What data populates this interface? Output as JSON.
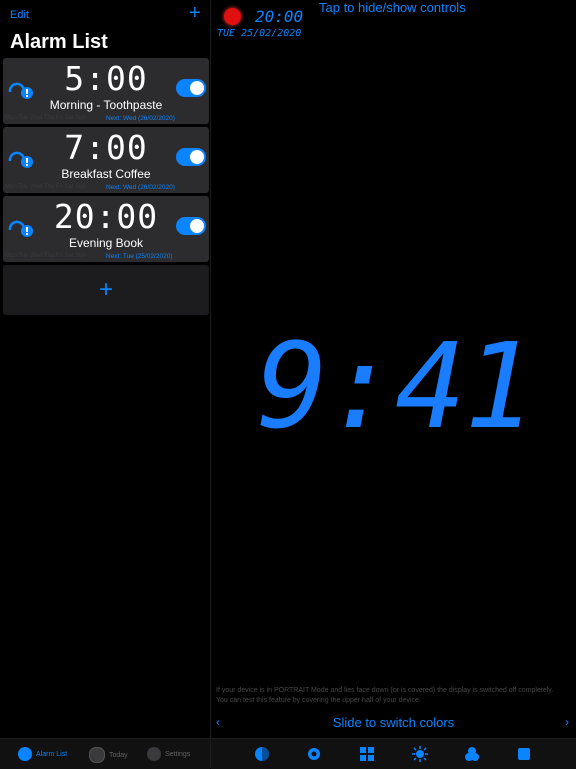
{
  "sidebar": {
    "edit_label": "Edit",
    "add_label": "+",
    "title": "Alarm List",
    "alarms": [
      {
        "time": "5:00",
        "label": "Morning - Toothpaste",
        "days": "Mon Tue Wed Thu Fri Sat Sun",
        "next": "Next: Wed (26/02/2020)"
      },
      {
        "time": "7:00",
        "label": "Breakfast Coffee",
        "days": "Mon Tue Wed Thu Fri Sat Sun",
        "next": "Next: Wed (26/02/2020)"
      },
      {
        "time": "20:00",
        "label": "Evening Book",
        "days": "Mon Tue Wed Thu Fri Sat Sun",
        "next": "Next: Tue (25/02/2020)"
      }
    ],
    "add_card_label": "+"
  },
  "tabs": [
    {
      "label": "Alarm List",
      "icon": "alarm-clock-icon",
      "active": true
    },
    {
      "label": "Today",
      "icon": "today-icon",
      "active": false
    },
    {
      "label": "Settings",
      "icon": "gear-icon",
      "active": false
    }
  ],
  "main": {
    "mini_time": "20:00",
    "mini_date": "TUE 25/02/2020",
    "tap_hint": "Tap to hide/show controls",
    "big_time": "9:41",
    "footnote": "If your device is in PORTRAIT Mode and lies face down (or is covered) the display is switched off completely. You can test this feature by covering the upper half of your device.",
    "slide_text": "Slide to switch colors",
    "slide_left": "‹",
    "slide_right": "›"
  },
  "controls": [
    "dimmer-icon",
    "gear-icon",
    "layout-icon",
    "brightness-icon",
    "color-icon",
    "stop-icon"
  ],
  "colors": {
    "accent": "#0a84ff",
    "digit": "#1a7cff",
    "dim_segment": "#0d1a33",
    "record": "#e01010"
  }
}
